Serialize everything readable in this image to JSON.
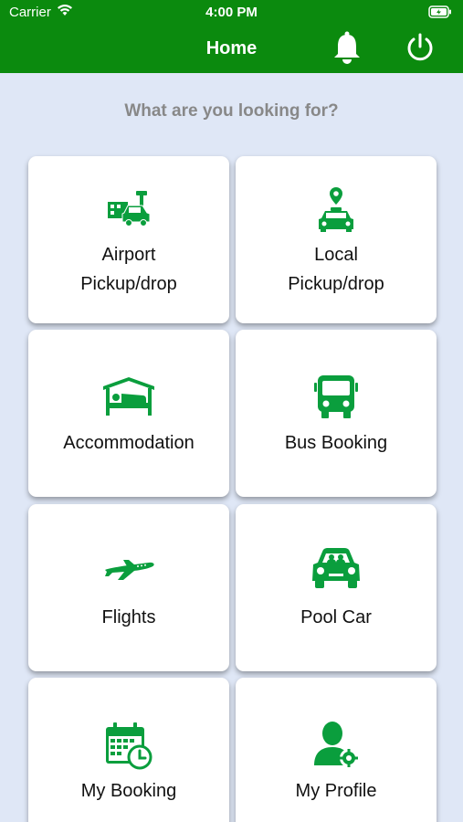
{
  "status_bar": {
    "carrier": "Carrier",
    "time": "4:00 PM"
  },
  "header": {
    "title": "Home",
    "bell_icon": "bell-icon",
    "power_icon": "power-icon",
    "color": "#0b8a0e"
  },
  "prompt": "What are you looking for?",
  "accent_color": "#0a9e3d",
  "tiles": [
    {
      "line1": "Airport",
      "line2": "Pickup/drop",
      "icon": "airport-car-icon"
    },
    {
      "line1": "Local",
      "line2": "Pickup/drop",
      "icon": "taxi-location-icon"
    },
    {
      "line1": "Accommodation",
      "line2": "",
      "icon": "hotel-bed-icon"
    },
    {
      "line1": "Bus Booking",
      "line2": "",
      "icon": "bus-icon"
    },
    {
      "line1": "Flights",
      "line2": "",
      "icon": "airplane-icon"
    },
    {
      "line1": "Pool Car",
      "line2": "",
      "icon": "car-icon"
    },
    {
      "line1": "My Booking",
      "line2": "",
      "icon": "calendar-clock-icon"
    },
    {
      "line1": "My Profile",
      "line2": "",
      "icon": "user-settings-icon"
    }
  ]
}
